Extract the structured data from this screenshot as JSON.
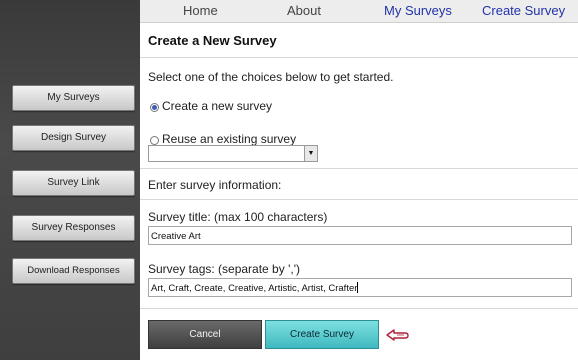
{
  "nav": {
    "home": "Home",
    "about": "About",
    "my_surveys": "My Surveys",
    "create_survey": "Create Survey"
  },
  "sidebar": {
    "items": [
      {
        "label": "My Surveys"
      },
      {
        "label": "Design Survey"
      },
      {
        "label": "Survey Link"
      },
      {
        "label": "Survey Responses"
      },
      {
        "label": "Download Responses"
      }
    ]
  },
  "page": {
    "title": "Create a New Survey",
    "instruction": "Select one of the choices below to get started.",
    "option_new": "Create a new survey",
    "option_reuse": "Reuse an existing survey",
    "existing_survey_value": "",
    "section_label": "Enter survey information:",
    "title_label": "Survey title: (max 100 characters)",
    "title_value": "Creative Art",
    "tags_label": "Survey tags: (separate by ',')",
    "tags_value": "Art, Craft, Create, Creative, Artistic, Artist, Crafter",
    "cancel_label": "Cancel",
    "create_label": "Create Survey"
  },
  "state": {
    "selected_option": "create_new"
  },
  "icons": {
    "select_arrow": "chevron-down-icon",
    "pointer": "pointing-hand-icon"
  },
  "colors": {
    "sidebar_bg": "#3f3f3f",
    "nav_link_active": "#2233aa",
    "create_button": "#4fc6cc",
    "cancel_button": "#4f4f4f"
  }
}
